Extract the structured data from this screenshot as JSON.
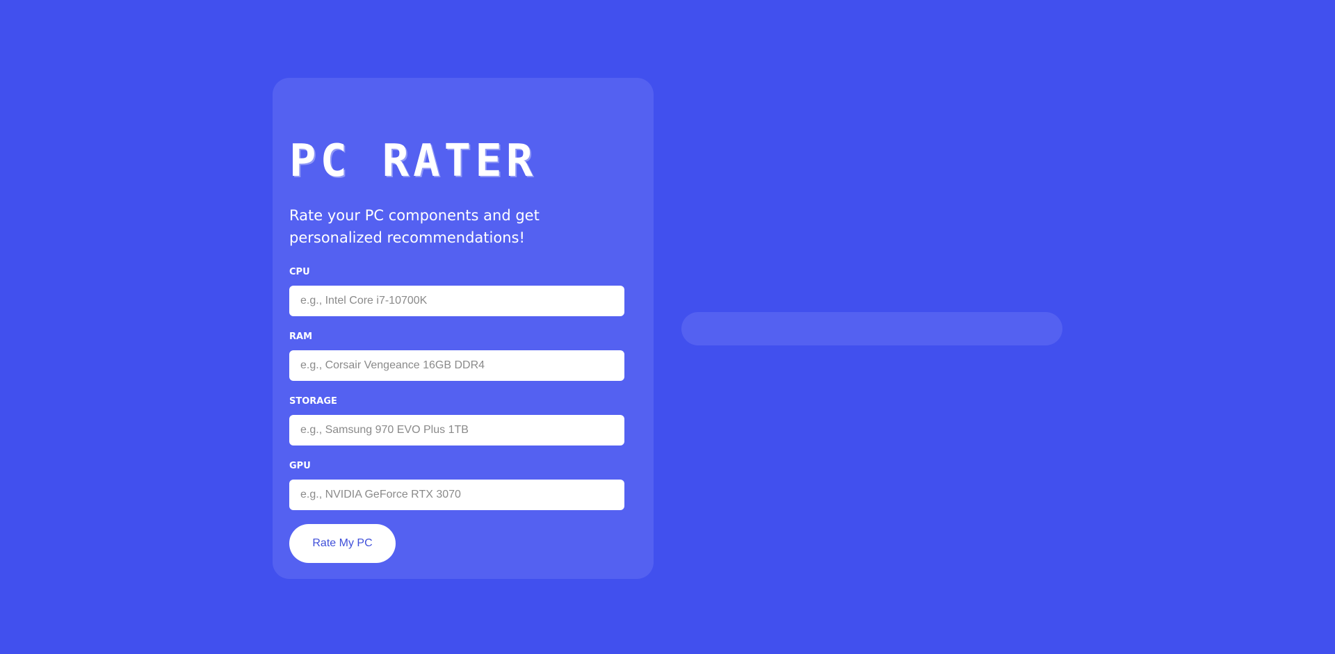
{
  "app": {
    "title": "PC RATER",
    "subtitle": "Rate your PC components and get personalized recommendations!"
  },
  "form": {
    "fields": [
      {
        "label": "CPU",
        "placeholder": "e.g., Intel Core i7-10700K",
        "value": ""
      },
      {
        "label": "RAM",
        "placeholder": "e.g., Corsair Vengeance 16GB DDR4",
        "value": ""
      },
      {
        "label": "STORAGE",
        "placeholder": "e.g., Samsung 970 EVO Plus 1TB",
        "value": ""
      },
      {
        "label": "GPU",
        "placeholder": "e.g., NVIDIA GeForce RTX 3070",
        "value": ""
      }
    ],
    "submit_label": "Rate My PC"
  },
  "colors": {
    "background": "#4150ee",
    "card": "#5461f1",
    "button_text": "#3f4fd9"
  }
}
